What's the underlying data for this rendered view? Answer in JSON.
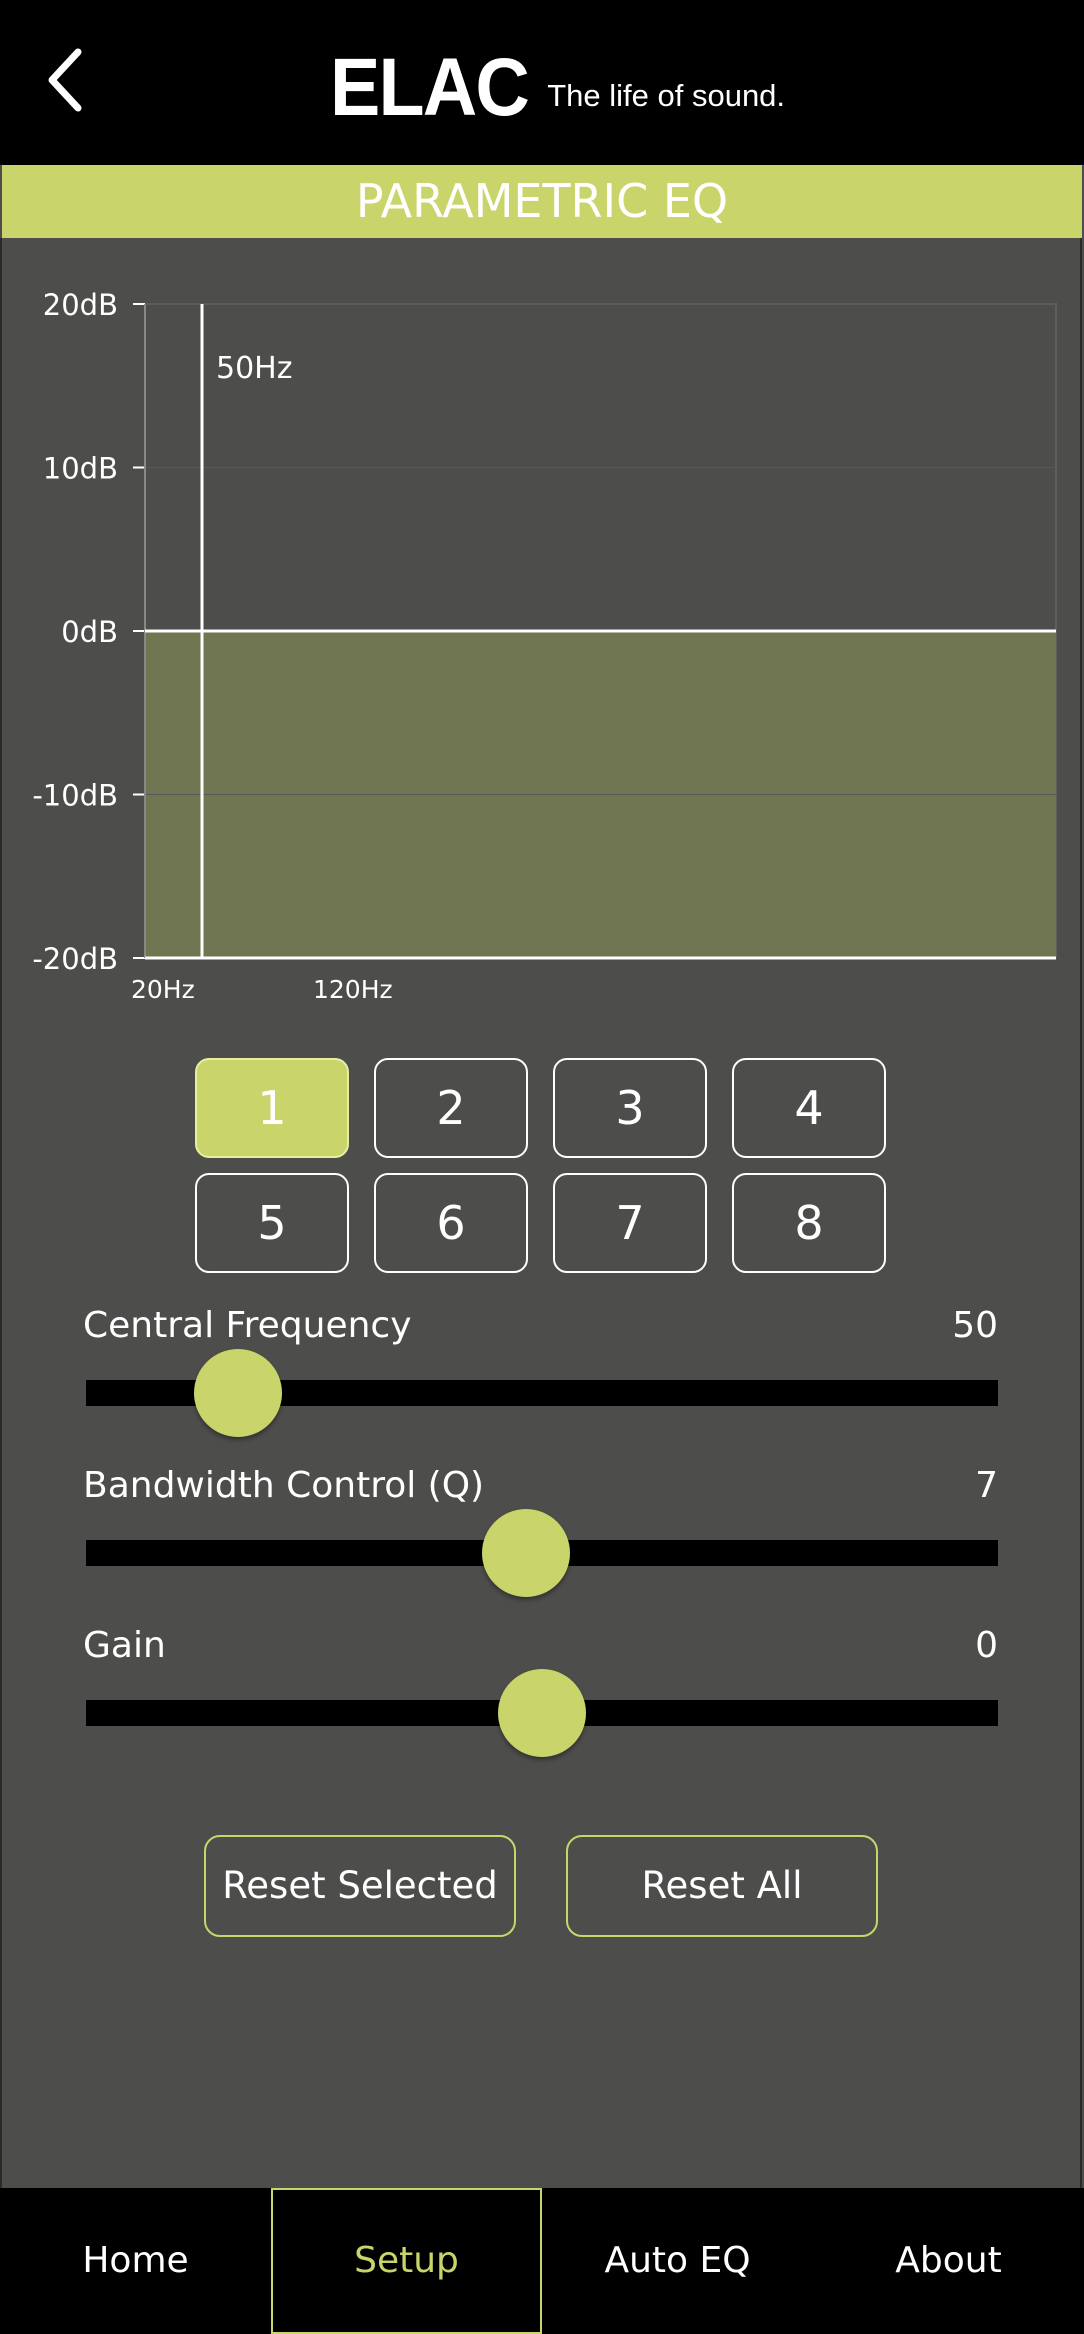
{
  "header": {
    "logo_mark": "ELAC",
    "logo_tagline": "The life of sound."
  },
  "page_title": "PARAMETRIC EQ",
  "colors": {
    "accent": "#c9d56a",
    "background": "#4d4d4c",
    "fill": "#707552"
  },
  "chart_data": {
    "type": "area",
    "y_tick_labels": [
      "20dB",
      "10dB",
      "0dB",
      "-10dB",
      "-20dB"
    ],
    "x_tick_labels": [
      "20Hz",
      "120Hz"
    ],
    "ylim": [
      -20,
      20
    ],
    "x_scale": "log",
    "marker_label": "50Hz",
    "marker_frequency": 50,
    "curve_gain_db": 0,
    "grid": true
  },
  "bands": {
    "selected": 1,
    "labels": [
      "1",
      "2",
      "3",
      "4",
      "5",
      "6",
      "7",
      "8"
    ]
  },
  "sliders": [
    {
      "label": "Central Frequency",
      "value": "50",
      "level": 0.167
    },
    {
      "label": "Bandwidth Control (Q)",
      "value": "7",
      "level": 0.482
    },
    {
      "label": "Gain",
      "value": "0",
      "level": 0.5
    }
  ],
  "actions": {
    "reset_selected": "Reset Selected",
    "reset_all": "Reset All"
  },
  "nav": {
    "items": [
      "Home",
      "Setup",
      "Auto EQ",
      "About"
    ],
    "active": "Setup"
  }
}
